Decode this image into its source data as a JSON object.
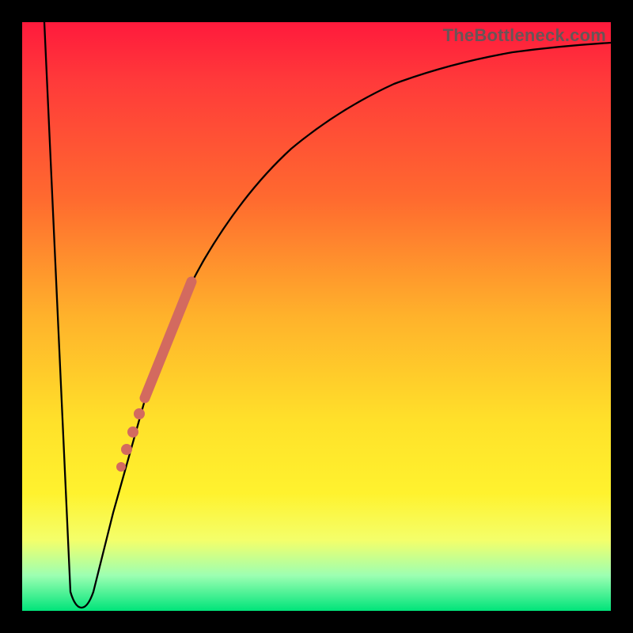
{
  "watermark": "TheBottleneck.com",
  "colors": {
    "gradient_top": "#ff1a3c",
    "gradient_mid1": "#ff6a2f",
    "gradient_mid2": "#ffe12a",
    "gradient_bottom": "#00e47a",
    "curve": "#000000",
    "highlight": "#d36a5f",
    "frame": "#000000"
  },
  "chart_data": {
    "type": "line",
    "title": "",
    "xlabel": "",
    "ylabel": "",
    "xlim": [
      0,
      100
    ],
    "ylim": [
      0,
      100
    ],
    "series": [
      {
        "name": "bottleneck-curve",
        "x": [
          0,
          2,
          4,
          6,
          8,
          10,
          11,
          12,
          14,
          16,
          20,
          24,
          28,
          32,
          36,
          40,
          45,
          50,
          55,
          60,
          65,
          70,
          75,
          80,
          85,
          90,
          95,
          100
        ],
        "y": [
          100,
          80,
          60,
          40,
          20,
          3,
          2,
          3,
          12,
          22,
          38,
          50,
          58,
          64,
          70,
          75,
          80,
          84,
          87,
          89,
          91,
          92.5,
          93.5,
          94.3,
          95,
          95.5,
          95.8,
          96
        ]
      }
    ],
    "highlight_segment": {
      "x_start": 20,
      "y_start": 38,
      "x_end": 28,
      "y_end": 58
    },
    "highlight_points": [
      {
        "x": 18.5,
        "y": 34
      },
      {
        "x": 17.2,
        "y": 30
      },
      {
        "x": 16.0,
        "y": 26.5
      },
      {
        "x": 15.0,
        "y": 23
      }
    ],
    "sweet_spot": {
      "x": 11,
      "y": 2
    }
  }
}
